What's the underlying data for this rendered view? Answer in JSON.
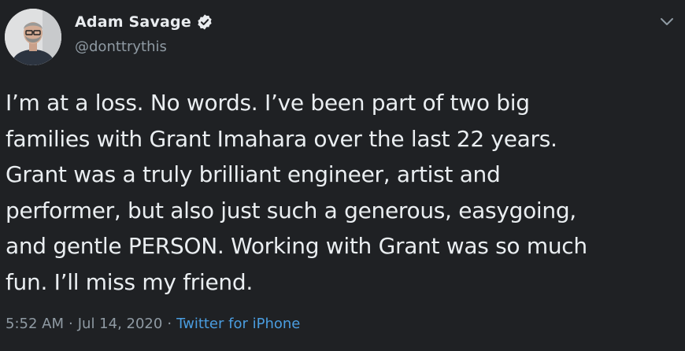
{
  "author": {
    "display_name": "Adam Savage",
    "handle": "@donttrythis",
    "verified": true
  },
  "icons": {
    "verified": "verified-badge-icon",
    "menu": "chevron-down-icon"
  },
  "tweet": {
    "text": "I’m at a loss. No words. I’ve been part of two big\nfamilies with Grant Imahara over the last 22 years.\nGrant was a truly brilliant engineer, artist and\nperformer, but also just such a generous, easygoing,\nand gentle PERSON. Working with Grant was so much\nfun. I’ll miss my friend.",
    "time": "5:52 AM",
    "date": "Jul 14, 2020",
    "separator": "·",
    "source": "Twitter for iPhone"
  },
  "colors": {
    "background": "#1f2124",
    "text": "#eaeef1",
    "muted": "#8f9aa3",
    "link": "#4a9de0"
  }
}
